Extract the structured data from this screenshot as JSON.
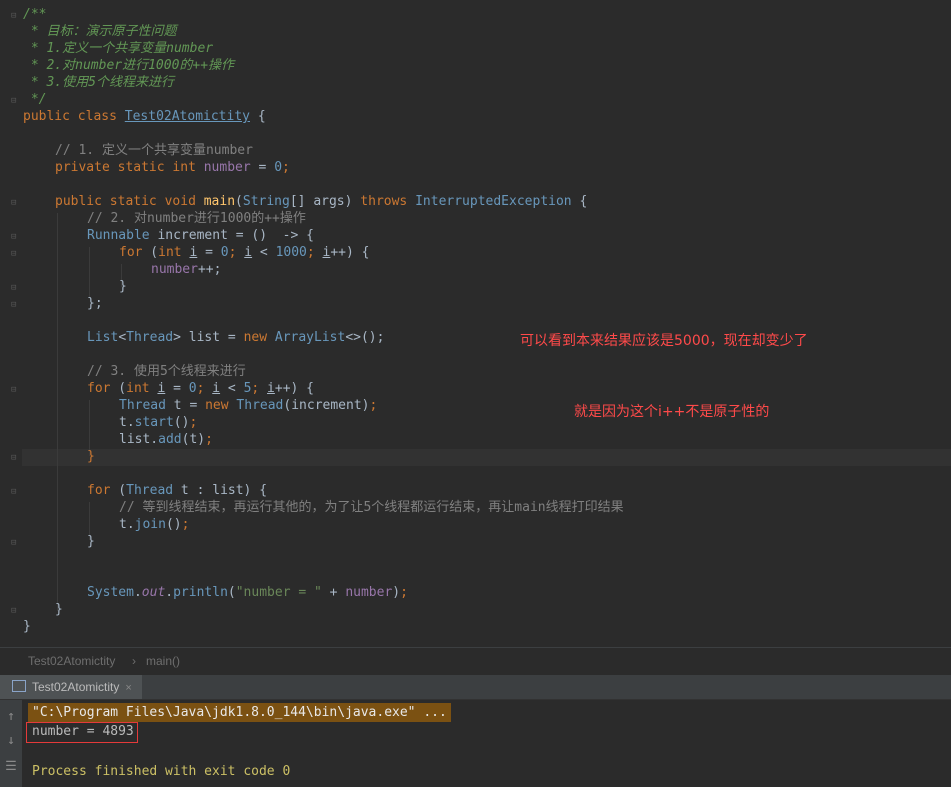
{
  "editor": {
    "lines": [
      "/**",
      " * 目标：演示原子性问题",
      " * 1.定义一个共享变量number",
      " * 2.对number进行1000的++操作",
      " * 3.使用5个线程来进行",
      " */",
      "public class Test02Atomictity {",
      "// 1. 定义一个共享变量number",
      "private static int number = 0;",
      "public static void main(String[] args) throws InterruptedException {",
      "// 2. 对number进行1000的++操作",
      "Runnable increment = ()  -> {",
      "for (int i = 0; i < 1000; i++) {",
      "number++;",
      "}",
      "};",
      "List<Thread> list = new ArrayList<>();",
      "// 3. 使用5个线程来进行",
      "for (int i = 0; i < 5; i++) {",
      "Thread t = new Thread(increment);",
      "t.start();",
      "list.add(t);",
      "}",
      "for (Thread t : list) {",
      "// 等到线程结束，再运行其他的，为了让5个线程都运行结束，再让main线程打印结果",
      "t.join();",
      "}",
      "System.out.println(\"number = \" + number);",
      "}",
      "}"
    ],
    "annotations": {
      "note1": "可以看到本来结果应该是5000，现在却变少了",
      "note2": "就是因为这个i++不是原子性的"
    }
  },
  "breadcrumb": {
    "class_name": "Test02Atomictity",
    "separator": "›",
    "method": "main()"
  },
  "run_panel": {
    "tab_label": "Test02Atomictity",
    "close": "×",
    "command": "\"C:\\Program Files\\Java\\jdk1.8.0_144\\bin\\java.exe\" ...",
    "output": "number = 4893",
    "finished": "Process finished with exit code 0",
    "icons": [
      "arrow-up-icon",
      "arrow-down-icon",
      "wrap-icon"
    ]
  },
  "colors": {
    "keyword": "#cc7832",
    "comment": "#629755",
    "number": "#6897bb",
    "field": "#9876aa",
    "string": "#6a8759",
    "annotation": "#ff4a4a"
  }
}
